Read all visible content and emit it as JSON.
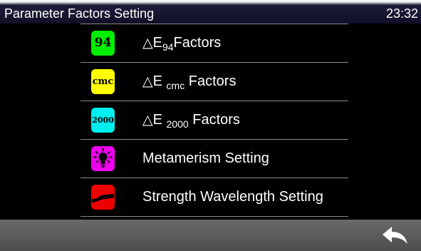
{
  "header": {
    "title": "Parameter Factors Setting",
    "time": "23:32"
  },
  "menu": {
    "items": [
      {
        "icon_text": "94",
        "icon_color": "#00ee00",
        "symbol": "△",
        "prefix": "E",
        "sub": "94",
        "suffix": "Factors"
      },
      {
        "icon_text": "cmc",
        "icon_color": "#ffff00",
        "symbol": "△",
        "prefix": "E",
        "sub": "cmc",
        "suffix": "Factors"
      },
      {
        "icon_text": "2000",
        "icon_color": "#00eeee",
        "symbol": "△",
        "prefix": "E",
        "sub": "2000",
        "suffix": "Factors"
      },
      {
        "label": "Metamerism Setting",
        "icon": "lightbulb-icon",
        "icon_color": "#ee00ee"
      },
      {
        "label": "Strength Wavelength Setting",
        "icon": "wave-curve-icon",
        "icon_color": "#ee0000"
      }
    ]
  },
  "footer": {
    "back_icon": "back-arrow-icon"
  }
}
